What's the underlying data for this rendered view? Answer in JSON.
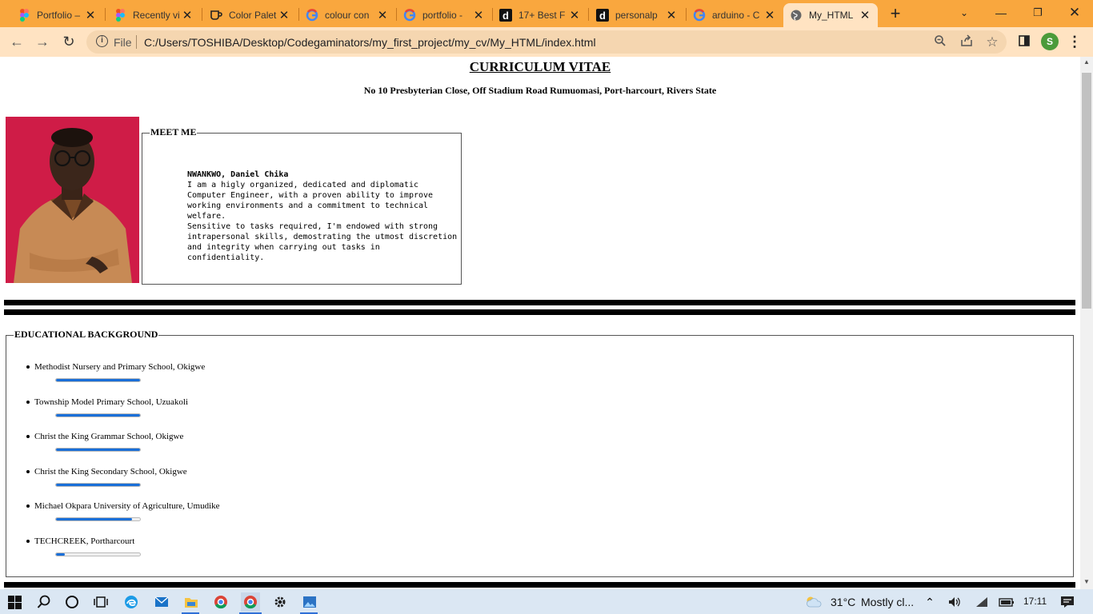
{
  "browser": {
    "tabs": [
      {
        "title": "Portfolio –",
        "favicon": "figma-icon"
      },
      {
        "title": "Recently vi",
        "favicon": "figma-icon"
      },
      {
        "title": "Color Palet",
        "favicon": "mug-icon"
      },
      {
        "title": "colour con",
        "favicon": "google-icon"
      },
      {
        "title": "portfolio -",
        "favicon": "google-icon"
      },
      {
        "title": "17+ Best F",
        "favicon": "d-icon"
      },
      {
        "title": "personalp",
        "favicon": "d-icon"
      },
      {
        "title": "arduino - C",
        "favicon": "google-icon"
      },
      {
        "title": "My_HTML",
        "favicon": "globe-icon",
        "active": true
      }
    ],
    "address": {
      "scheme_label": "File",
      "url": "C:/Users/TOSHIBA/Desktop/Codegaminators/my_first_project/my_cv/My_HTML/index.html"
    },
    "profile_initial": "S",
    "colors": {
      "tab_strip": "#f9a73e",
      "toolbar": "#ffe3c2",
      "accent": "#1a6fd8"
    }
  },
  "page": {
    "title": "CURRICULUM VITAE",
    "address": "No 10 Presbyterian Close, Off Stadium Road Rumuomasi, Port-harcourt, Rivers State",
    "meet": {
      "legend": "MEET ME",
      "name": "NWANKWO, Daniel Chika",
      "lines": [
        "I am a higly organized, dedicated and diplomatic",
        "Computer Engineer, with a proven ability to improve",
        "working environments and a commitment to technical",
        "welfare.",
        "Sensitive to tasks required, I'm endowed with strong",
        "intrapersonal skills, demostrating the utmost discretion",
        "and integrity when carrying out tasks in confidentiality."
      ]
    },
    "education": {
      "legend": "EDUCATIONAL BACKGROUND",
      "items": [
        {
          "school": "Methodist Nursery and Primary School, Okigwe",
          "progress": 100
        },
        {
          "school": "Township Model Primary School, Uzuakoli",
          "progress": 100
        },
        {
          "school": "Christ the King Grammar School, Okigwe",
          "progress": 100
        },
        {
          "school": "Christ the King Secondary School, Okigwe",
          "progress": 100
        },
        {
          "school": "Michael Okpara University of Agriculture, Umudike",
          "progress": 90
        },
        {
          "school": "TECHCREEK, Portharcourt",
          "progress": 10
        }
      ]
    }
  },
  "taskbar": {
    "temperature": "31°C",
    "weather": "Mostly cl...",
    "time": "17:11"
  }
}
